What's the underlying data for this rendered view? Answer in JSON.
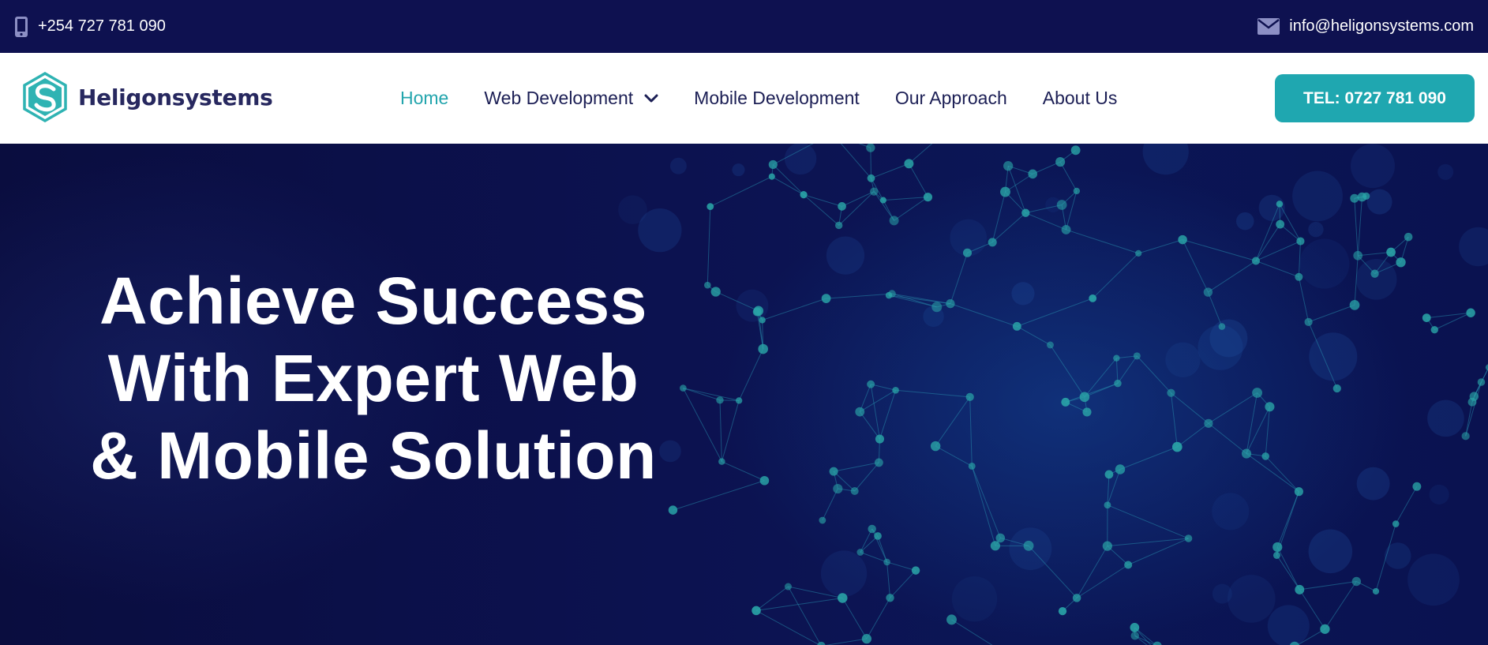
{
  "topbar": {
    "phone": "+254 727 781 090",
    "phone_icon": "mobile-phone-icon",
    "email": "info@heligonsystems.com",
    "email_icon": "envelope-icon"
  },
  "brand": {
    "name": "Heligonsystems",
    "logo_icon": "hexagon-s-logo-icon",
    "color": "#27285f",
    "accent": "#23a5ad"
  },
  "nav": {
    "items": [
      {
        "label": "Home",
        "active": true
      },
      {
        "label": "Web Development",
        "has_dropdown": true
      },
      {
        "label": "Mobile Development"
      },
      {
        "label": "Our Approach"
      },
      {
        "label": "About Us"
      }
    ],
    "dropdown_icon": "chevron-down-icon"
  },
  "cta": {
    "label": "TEL: 0727 781 090",
    "color": "#1fa7b0"
  },
  "hero": {
    "headline_lines": [
      "Achieve Success",
      "With Expert Web",
      "& Mobile Solution"
    ],
    "background": "globe-network-graphic",
    "background_color": "#0b0f45"
  }
}
